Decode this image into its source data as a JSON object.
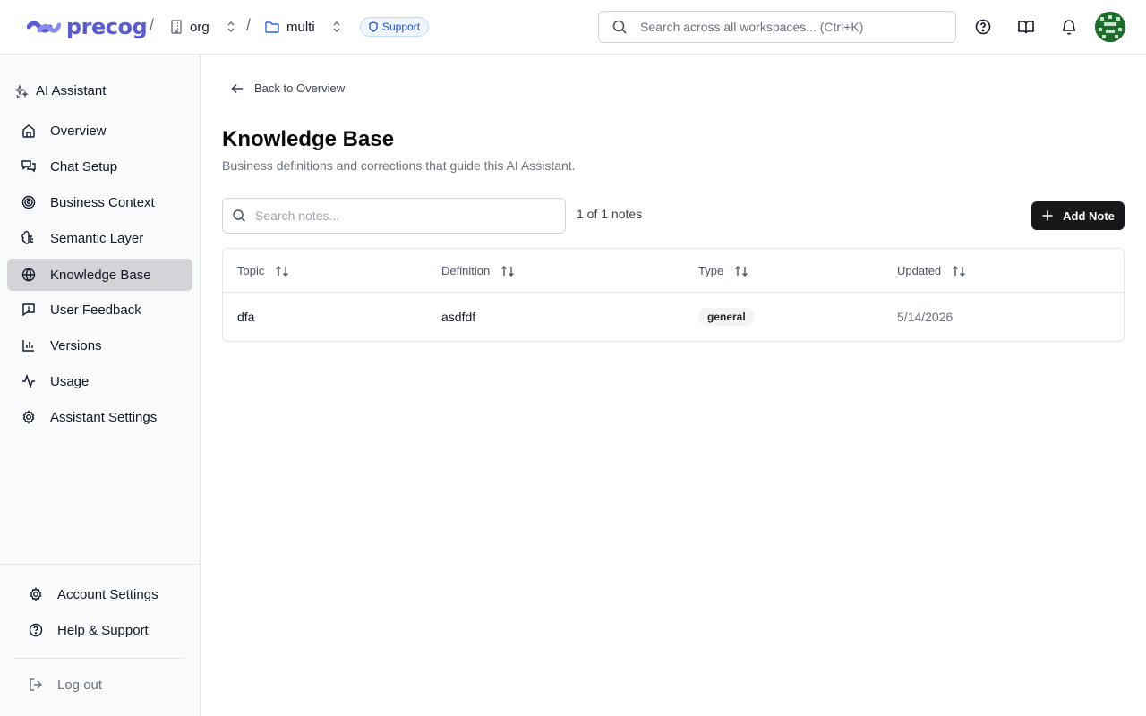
{
  "header": {
    "logo_text": "precog",
    "org": "org",
    "workspace": "multi",
    "support_label": "Support",
    "search_placeholder": "Search across all workspaces... (Ctrl+K)",
    "brand_color": "#5b5bd6"
  },
  "sidebar": {
    "title": "AI Assistant",
    "items": [
      {
        "label": "Overview",
        "icon": "home-icon"
      },
      {
        "label": "Chat Setup",
        "icon": "chat-icon"
      },
      {
        "label": "Business Context",
        "icon": "target-icon"
      },
      {
        "label": "Semantic Layer",
        "icon": "brain-icon"
      },
      {
        "label": "Knowledge Base",
        "icon": "globe-icon",
        "active": true
      },
      {
        "label": "User Feedback",
        "icon": "feedback-icon"
      },
      {
        "label": "Versions",
        "icon": "bar-chart-icon"
      },
      {
        "label": "Usage",
        "icon": "activity-icon"
      },
      {
        "label": "Assistant Settings",
        "icon": "gear-icon"
      }
    ],
    "footer": {
      "account_settings": "Account Settings",
      "help_support": "Help & Support",
      "log_out": "Log out"
    }
  },
  "main": {
    "back_label": "Back to Overview",
    "title": "Knowledge Base",
    "subtitle": "Business definitions and corrections that guide this AI Assistant.",
    "search_placeholder": "Search notes...",
    "count_text": "1 of 1 notes",
    "add_button": "Add Note",
    "table": {
      "columns": [
        "Topic",
        "Definition",
        "Type",
        "Updated"
      ],
      "rows": [
        {
          "topic": "dfa",
          "definition": "asdfdf",
          "type": "general",
          "updated": "5/14/2026"
        }
      ]
    }
  }
}
